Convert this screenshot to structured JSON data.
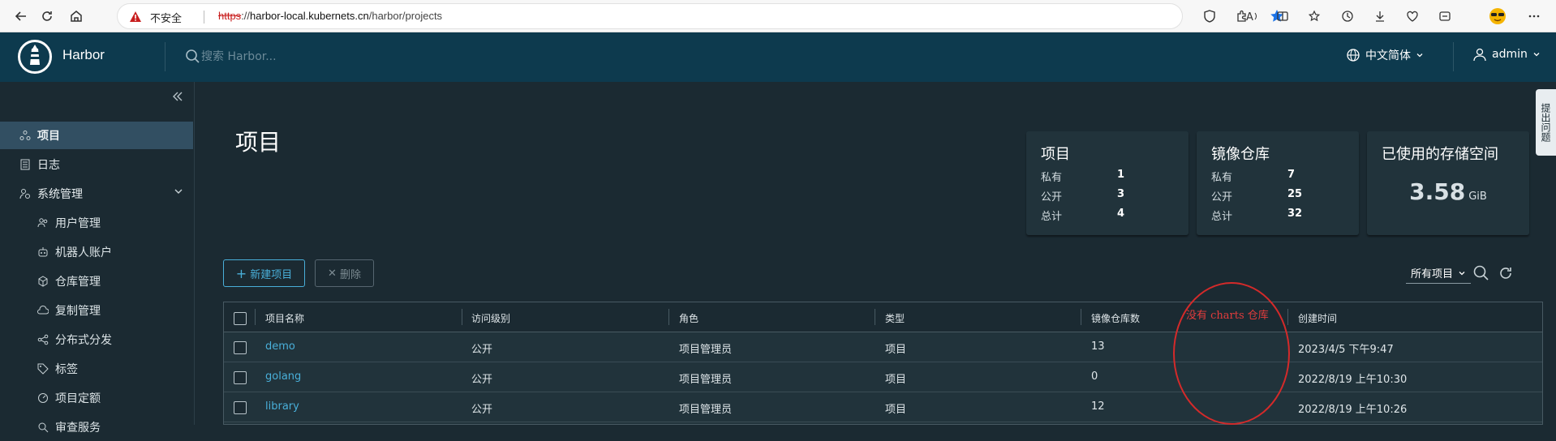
{
  "browser": {
    "security_label": "不安全",
    "url_scheme": "https",
    "url_sep": "://",
    "url_host": "harbor-local.kubernets.cn",
    "url_path": "/harbor/projects"
  },
  "header": {
    "brand": "Harbor",
    "search_placeholder": "搜索 Harbor...",
    "language": "中文简体",
    "user": "admin"
  },
  "sidebar": {
    "items": [
      {
        "label": "项目",
        "icon": "projects-icon"
      },
      {
        "label": "日志",
        "icon": "logs-icon"
      },
      {
        "label": "系统管理",
        "icon": "admin-icon"
      },
      {
        "label": "用户管理",
        "icon": "users-icon"
      },
      {
        "label": "机器人账户",
        "icon": "robot-icon"
      },
      {
        "label": "仓库管理",
        "icon": "registry-icon"
      },
      {
        "label": "复制管理",
        "icon": "replication-icon"
      },
      {
        "label": "分布式分发",
        "icon": "distribution-icon"
      },
      {
        "label": "标签",
        "icon": "tag-icon"
      },
      {
        "label": "项目定额",
        "icon": "quota-icon"
      },
      {
        "label": "审查服务",
        "icon": "interrogation-icon"
      }
    ]
  },
  "main": {
    "title": "项目",
    "cards": {
      "projects": {
        "title": "项目",
        "rows": [
          {
            "label": "私有",
            "value": "1"
          },
          {
            "label": "公开",
            "value": "3"
          },
          {
            "label": "总计",
            "value": "4"
          }
        ]
      },
      "repositories": {
        "title": "镜像仓库",
        "rows": [
          {
            "label": "私有",
            "value": "7"
          },
          {
            "label": "公开",
            "value": "25"
          },
          {
            "label": "总计",
            "value": "32"
          }
        ]
      },
      "storage": {
        "title": "已使用的存储空间",
        "value": "3.58",
        "unit": "GiB"
      }
    },
    "new_project_label": "新建项目",
    "delete_label": "删除",
    "filter_value": "所有项目",
    "table": {
      "headers": [
        "项目名称",
        "访问级别",
        "角色",
        "类型",
        "镜像仓库数",
        "创建时间"
      ],
      "rows": [
        {
          "name": "demo",
          "access": "公开",
          "role": "项目管理员",
          "type": "项目",
          "repo_count": "13",
          "created": "2023/4/5 下午9:47"
        },
        {
          "name": "golang",
          "access": "公开",
          "role": "项目管理员",
          "type": "项目",
          "repo_count": "0",
          "created": "2022/8/19 上午10:30"
        },
        {
          "name": "library",
          "access": "公开",
          "role": "项目管理员",
          "type": "项目",
          "repo_count": "12",
          "created": "2022/8/19 上午10:26"
        }
      ]
    },
    "annotation": "没有 charts 仓库"
  },
  "feedback": "提出问题"
}
